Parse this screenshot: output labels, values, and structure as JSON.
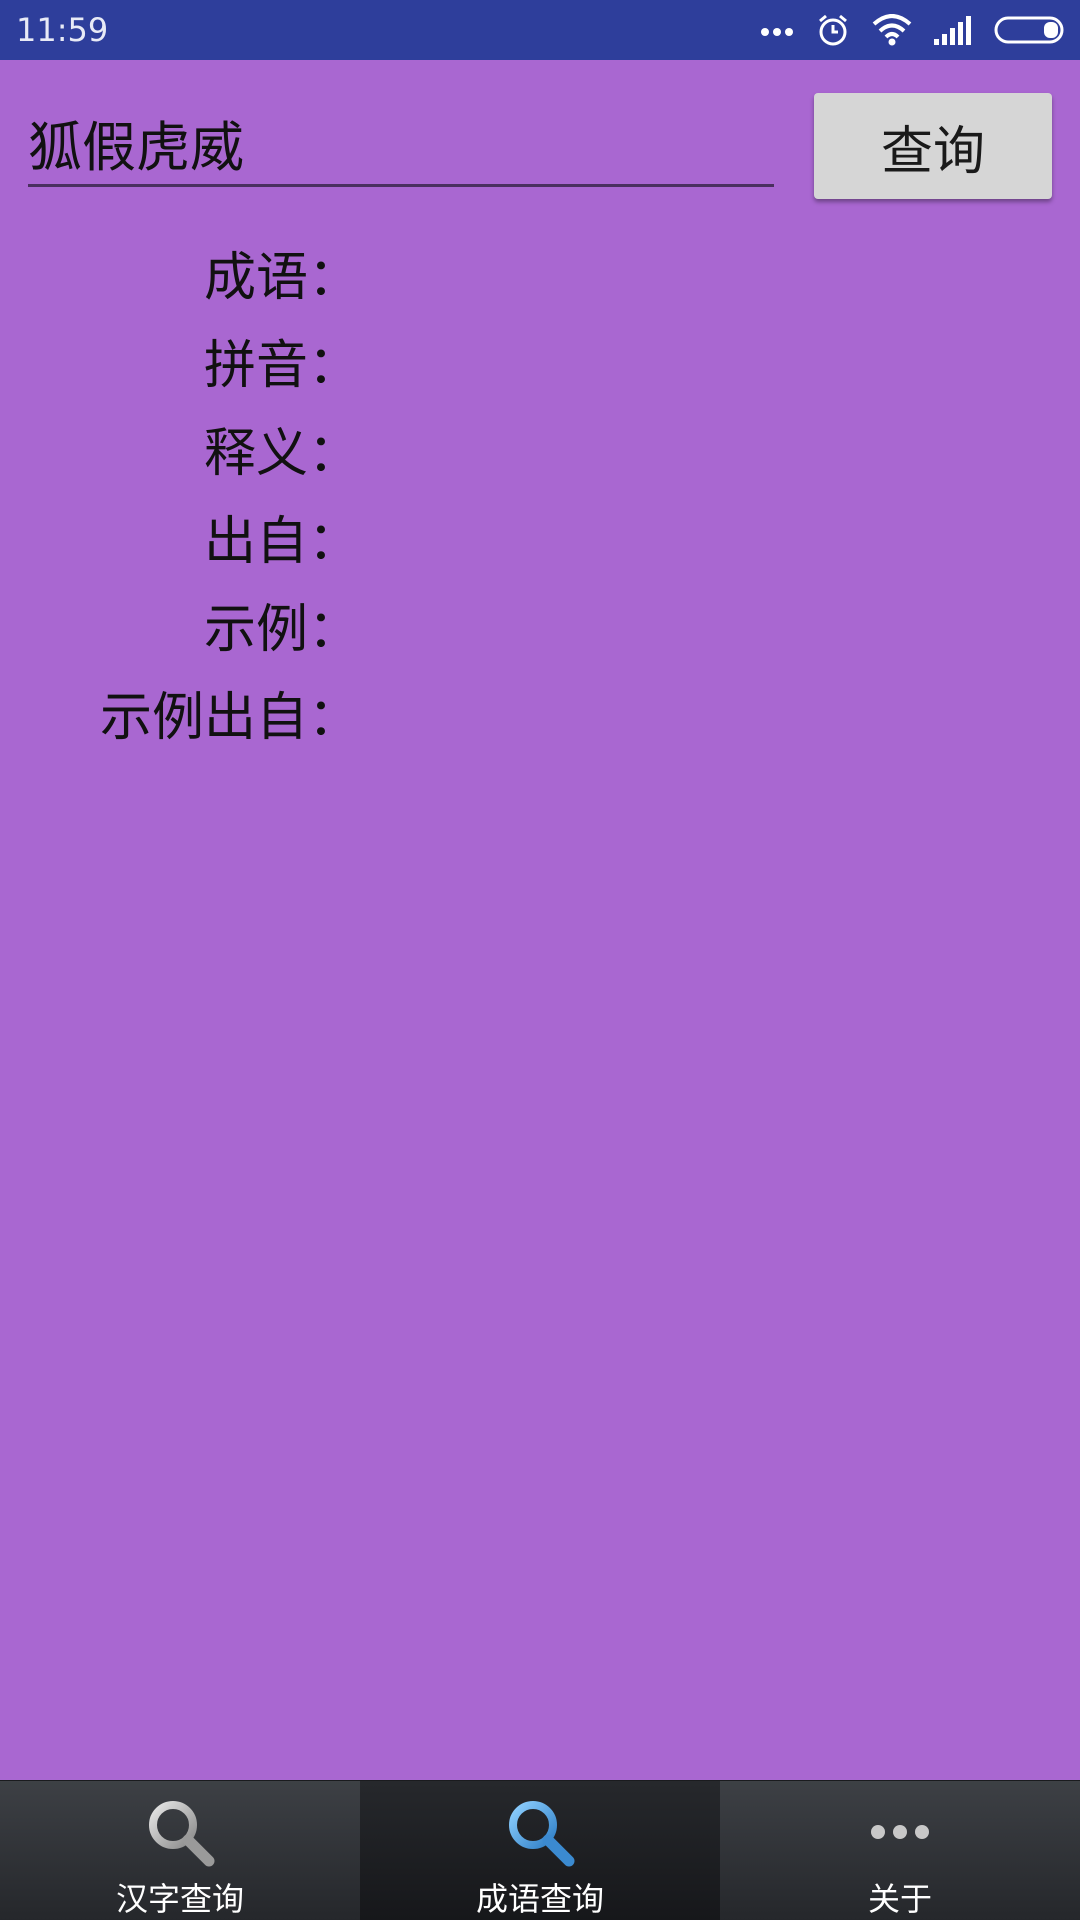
{
  "status_bar": {
    "time": "11:59",
    "icons": [
      "more-dots-icon",
      "alarm-icon",
      "wifi-icon",
      "signal-icon",
      "battery-icon"
    ]
  },
  "search": {
    "value": "狐假虎威",
    "button_label": "查询"
  },
  "results": [
    {
      "label": "成语：",
      "value": ""
    },
    {
      "label": "拼音：",
      "value": ""
    },
    {
      "label": "释义：",
      "value": ""
    },
    {
      "label": "出自：",
      "value": ""
    },
    {
      "label": "示例：",
      "value": ""
    },
    {
      "label": "示例出自：",
      "value": ""
    }
  ],
  "tabs": [
    {
      "label": "汉字查询",
      "icon": "magnifier-icon",
      "active": false
    },
    {
      "label": "成语查询",
      "icon": "magnifier-icon",
      "active": true
    },
    {
      "label": "关于",
      "icon": "more-dots-icon",
      "active": false
    }
  ],
  "colors": {
    "status_bar": "#2e3e9b",
    "background": "#a967d1",
    "button": "#d6d6d6",
    "tab_bar": "#2e3034",
    "active_icon": "#4a9fe0"
  }
}
